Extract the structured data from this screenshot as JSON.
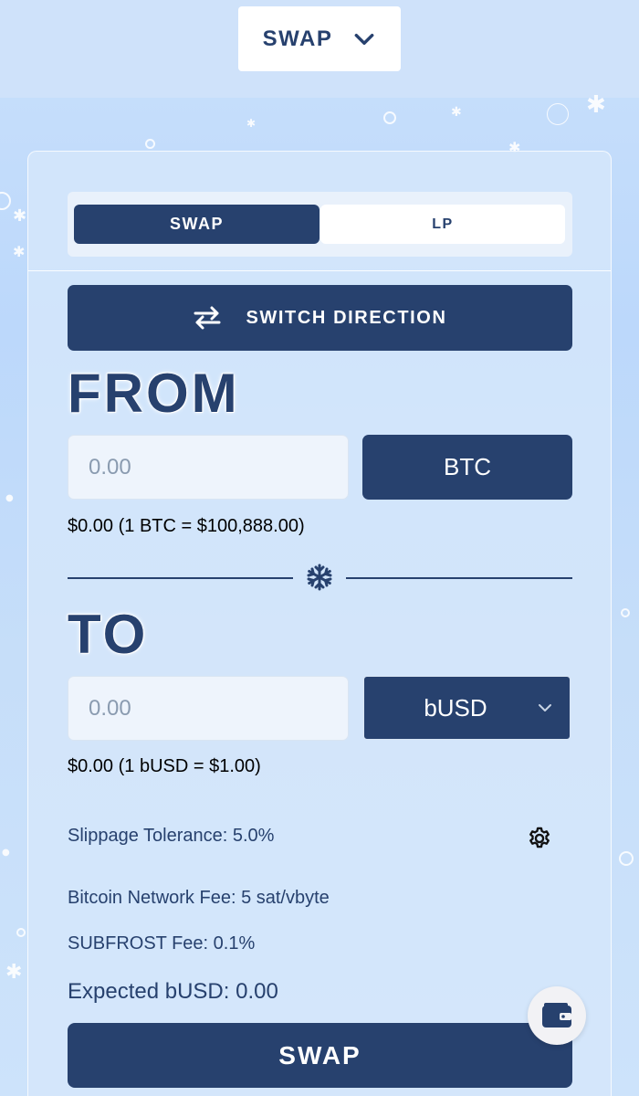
{
  "header": {
    "nav_label": "SWAP"
  },
  "tabs": [
    {
      "label": "SWAP",
      "active": true
    },
    {
      "label": "LP",
      "active": false
    }
  ],
  "switch_direction_label": "SWITCH DIRECTION",
  "from": {
    "title": "FROM",
    "amount_placeholder": "0.00",
    "token": "BTC",
    "rate_text": "$0.00 (1 BTC = $100,888.00)"
  },
  "to": {
    "title": "TO",
    "amount_placeholder": "0.00",
    "token": "bUSD",
    "rate_text": "$0.00 (1 bUSD = $1.00)"
  },
  "details": {
    "slippage": "Slippage Tolerance: 5.0%",
    "network_fee": "Bitcoin Network Fee: 5 sat/vbyte",
    "subfrost_fee": "SUBFROST Fee: 0.1%",
    "expected": "Expected bUSD: 0.00"
  },
  "swap_button_label": "SWAP",
  "icons": {
    "nav_chevron": "chevron-down-icon",
    "switch": "switch-arrows-icon",
    "separator": "snowflake-icon",
    "token_chevron": "chevron-down-icon",
    "settings": "gear-icon",
    "wallet": "wallet-icon"
  },
  "colors": {
    "primary": "#27416e",
    "background": "#c6def9",
    "panel": "#d5e6fa",
    "input_bg": "#eef4fc",
    "white": "#ffffff"
  }
}
